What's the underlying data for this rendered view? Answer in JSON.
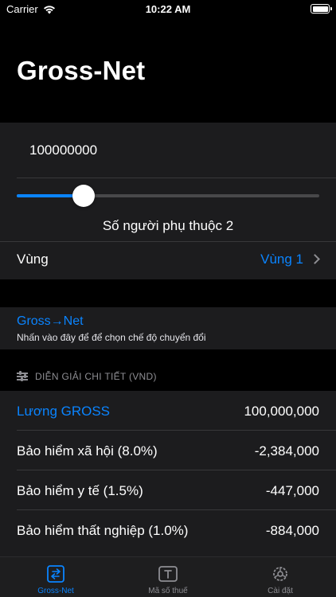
{
  "status_bar": {
    "carrier": "Carrier",
    "time": "10:22 AM"
  },
  "page_title": "Gross-Net",
  "salary_input": {
    "value": "100000000"
  },
  "dependents": {
    "label": "Số người phụ thuộc 2",
    "value_fraction": 0.22
  },
  "region": {
    "label": "Vùng",
    "value": "Vùng 1"
  },
  "mode": {
    "title": "Gross→Net",
    "subtitle": "Nhấn vào đây để để chọn chế độ chuyển đổi"
  },
  "breakdown": {
    "header": "DIỄN GIẢI CHI TIẾT (VND)",
    "rows": [
      {
        "label": "Lương GROSS",
        "value": "100,000,000"
      },
      {
        "label": "Bảo hiểm xã hội (8.0%)",
        "value": "-2,384,000"
      },
      {
        "label": "Bảo hiểm y tế (1.5%)",
        "value": "-447,000"
      },
      {
        "label": "Bảo hiểm thất nghiệp (1.0%)",
        "value": "-884,000"
      }
    ]
  },
  "tabs": [
    {
      "label": "Gross-Net",
      "icon": "swap-icon",
      "active": true
    },
    {
      "label": "Mã số thuế",
      "icon": "tax-code-icon",
      "active": false
    },
    {
      "label": "Cài đặt",
      "icon": "settings-gear-icon",
      "active": false
    }
  ],
  "colors": {
    "accent": "#0a84ff",
    "background": "#000000",
    "cell": "#1c1c1e",
    "secondary_text": "#8e8e93"
  }
}
